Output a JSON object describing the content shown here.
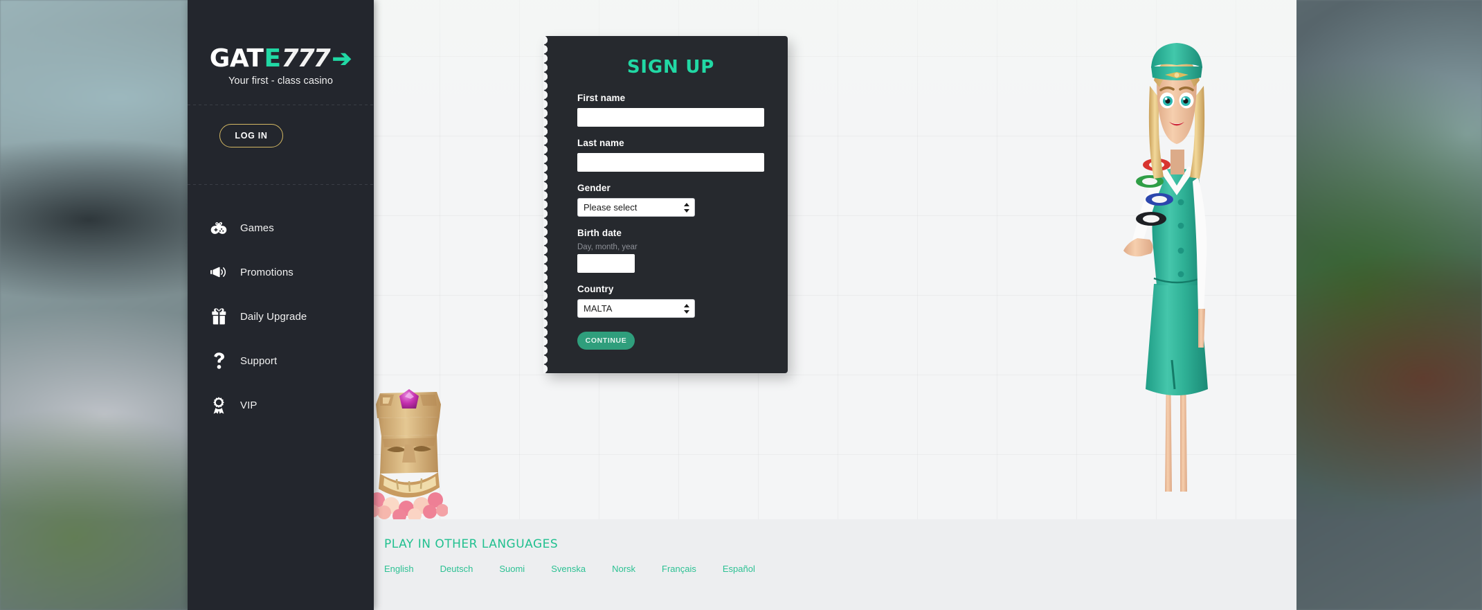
{
  "brand": {
    "logo_part1": "GAT",
    "logo_part2": "E",
    "logo_part3": "777",
    "logo_arrow": "➔",
    "tagline": "Your first - class casino"
  },
  "sidebar": {
    "login_label": "LOG IN",
    "items": [
      {
        "label": "Games",
        "icon": "gamepad-icon"
      },
      {
        "label": "Promotions",
        "icon": "megaphone-icon"
      },
      {
        "label": "Daily Upgrade",
        "icon": "gift-icon"
      },
      {
        "label": "Support",
        "icon": "question-mark-icon"
      },
      {
        "label": "VIP",
        "icon": "award-medal-icon"
      }
    ]
  },
  "signup": {
    "title": "SIGN UP",
    "first_name": {
      "label": "First name",
      "value": "",
      "placeholder": ""
    },
    "last_name": {
      "label": "Last name",
      "value": "",
      "placeholder": ""
    },
    "gender": {
      "label": "Gender",
      "selected": "Please select"
    },
    "birth_date": {
      "label": "Birth date",
      "hint": "Day, month, year",
      "value": "",
      "placeholder": ""
    },
    "country": {
      "label": "Country",
      "selected": "MALTA"
    },
    "continue_label": "CONTINUE"
  },
  "languages": {
    "heading": "PLAY IN OTHER LANGUAGES",
    "items": [
      "English",
      "Deutsch",
      "Suomi",
      "Svenska",
      "Norsk",
      "Français",
      "Español"
    ]
  },
  "colors": {
    "accent_teal": "#21d8a4",
    "link_teal": "#2cc193",
    "button_green": "#2f9e7c",
    "login_gold": "#d4b863",
    "sidebar_bg": "#23262d",
    "card_bg": "#26292e",
    "content_bg": "#edeef0"
  }
}
